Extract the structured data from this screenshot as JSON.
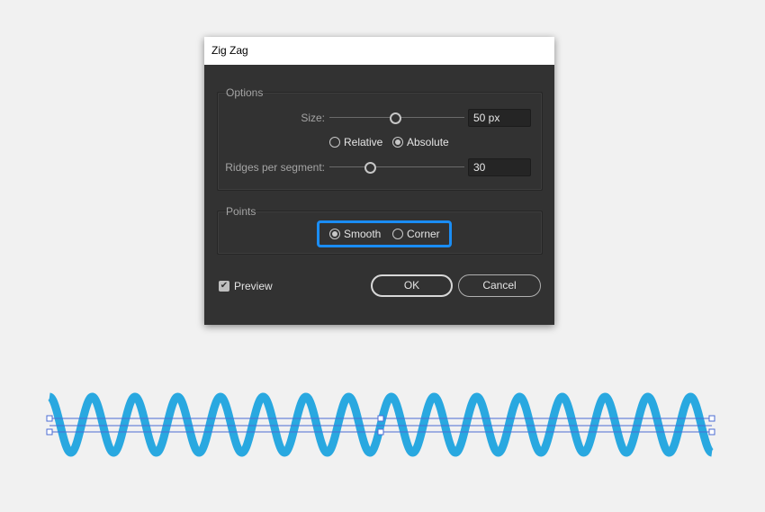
{
  "dialog": {
    "title": "Zig Zag",
    "options": {
      "group_label": "Options",
      "size_label": "Size:",
      "size_value": "50 px",
      "size_slider_fraction": 0.49,
      "relative_label": "Relative",
      "absolute_label": "Absolute",
      "selected_mode": "Absolute",
      "ridges_label": "Ridges per segment:",
      "ridges_value": "30",
      "ridges_slider_fraction": 0.3
    },
    "points": {
      "group_label": "Points",
      "smooth_label": "Smooth",
      "corner_label": "Corner",
      "selected": "Smooth"
    },
    "preview_label": "Preview",
    "preview_checked": true,
    "ok_label": "OK",
    "cancel_label": "Cancel"
  },
  "colors": {
    "wave": "#29a8e0",
    "selection": "#4b6cd4",
    "focus": "#1a8df5"
  }
}
